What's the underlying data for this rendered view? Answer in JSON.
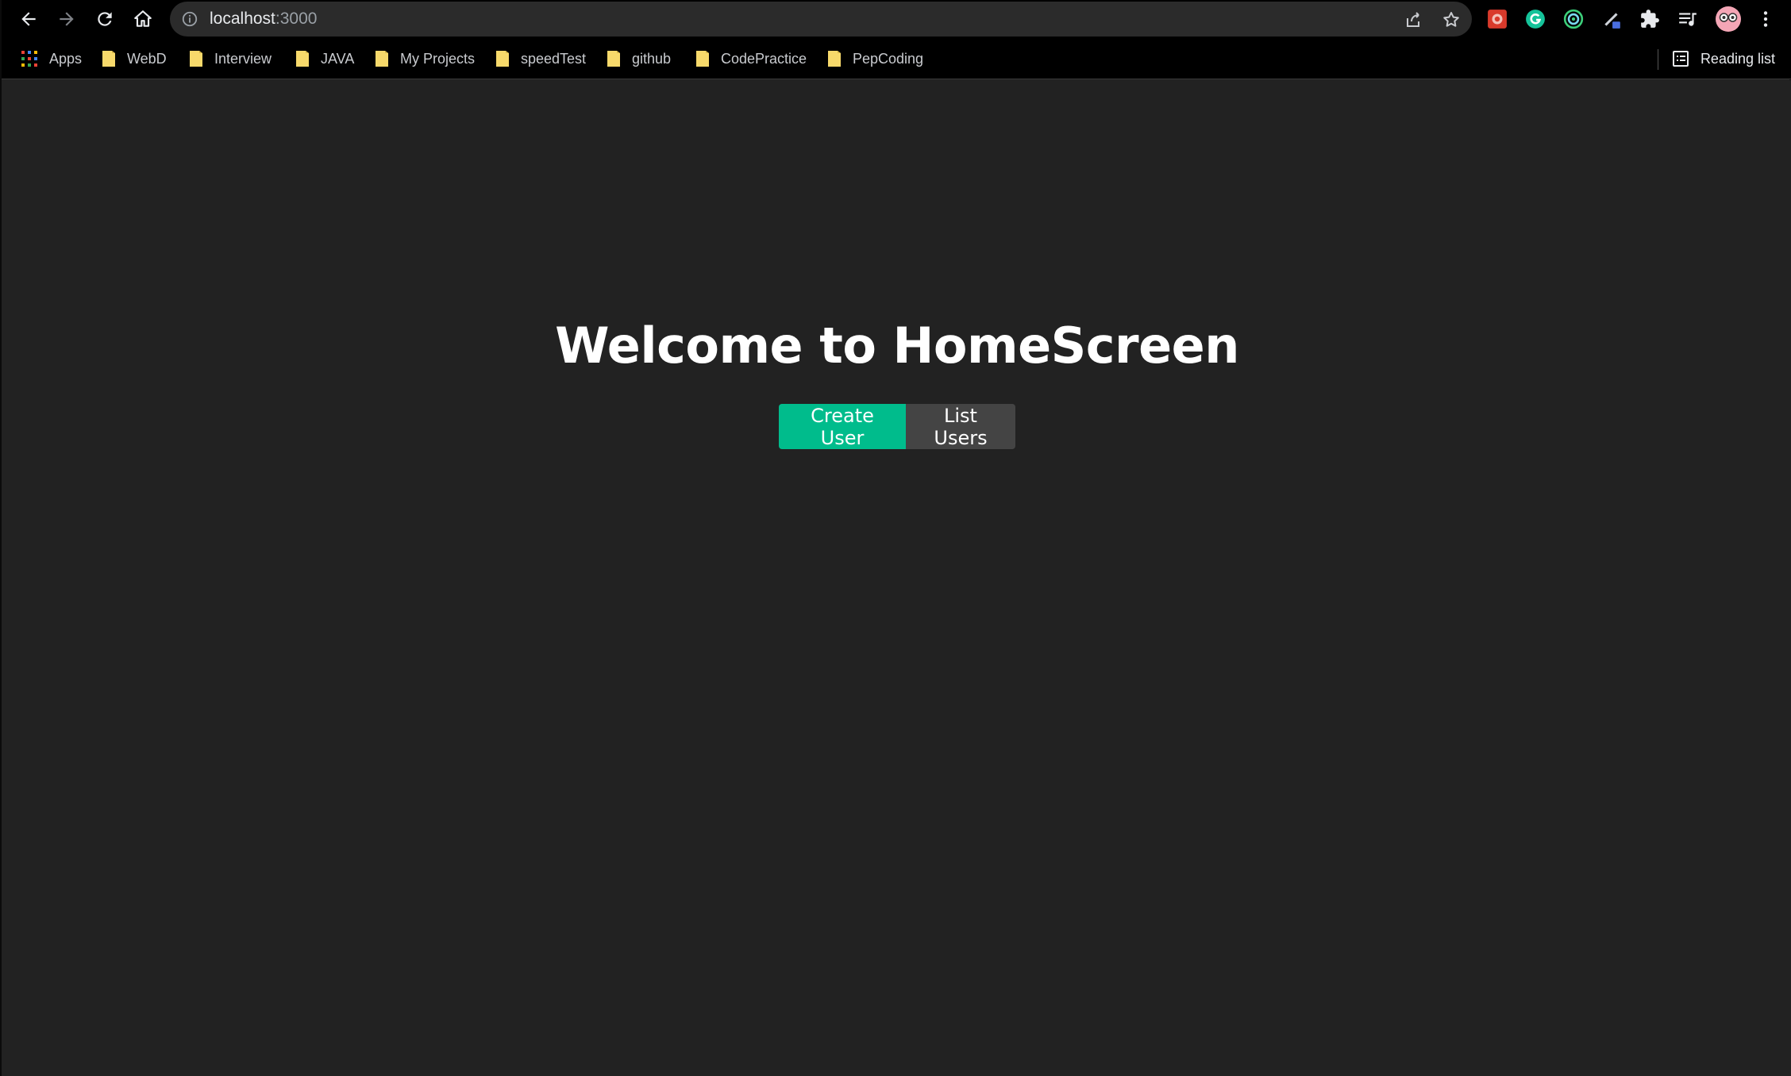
{
  "browser": {
    "address_bar": {
      "host": "localhost",
      "port": ":3000"
    },
    "bookmarks": [
      {
        "label": "Apps",
        "icon": "apps-grid-icon"
      },
      {
        "label": "WebD",
        "icon": "folder-icon"
      },
      {
        "label": "Interview",
        "icon": "folder-icon"
      },
      {
        "label": "JAVA",
        "icon": "folder-icon"
      },
      {
        "label": "My Projects",
        "icon": "folder-icon"
      },
      {
        "label": "speedTest",
        "icon": "folder-icon"
      },
      {
        "label": "github",
        "icon": "folder-icon"
      },
      {
        "label": "CodePractice",
        "icon": "folder-icon"
      },
      {
        "label": "PepCoding",
        "icon": "folder-icon"
      }
    ],
    "reading_list_label": "Reading list",
    "extensions": [
      "extension-red-icon",
      "grammarly-icon",
      "target-icon",
      "pen-icon",
      "puzzle-icon",
      "media-queue-icon",
      "profile-avatar",
      "menu-dots-icon"
    ]
  },
  "main": {
    "heading": "Welcome to HomeScreen",
    "buttons": {
      "create_user": "Create User",
      "list_users": "List Users"
    }
  },
  "colors": {
    "page_background": "#222222",
    "primary_button": "#00bc8c",
    "secondary_button": "#444444",
    "chrome_background": "#000000"
  }
}
